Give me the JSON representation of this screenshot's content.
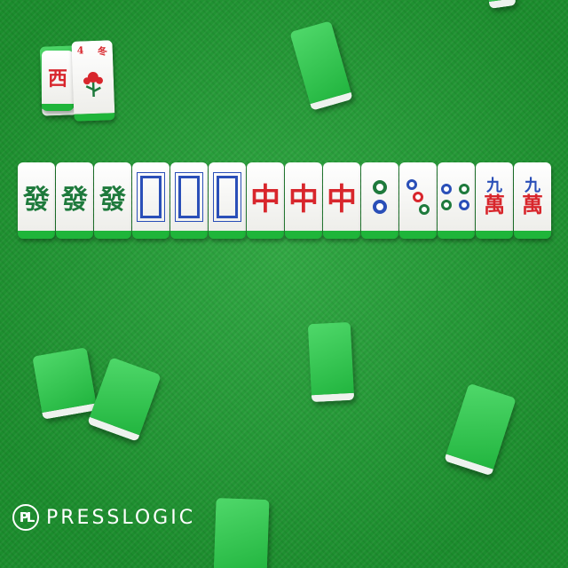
{
  "tiles_row": [
    {
      "kind": "character",
      "glyph": "發"
    },
    {
      "kind": "character",
      "glyph": "發"
    },
    {
      "kind": "character",
      "glyph": "發"
    },
    {
      "kind": "white-dragon"
    },
    {
      "kind": "white-dragon"
    },
    {
      "kind": "white-dragon"
    },
    {
      "kind": "character",
      "glyph": "中"
    },
    {
      "kind": "character",
      "glyph": "中"
    },
    {
      "kind": "character",
      "glyph": "中"
    },
    {
      "kind": "circles",
      "count": 2
    },
    {
      "kind": "circles",
      "count": 3
    },
    {
      "kind": "circles",
      "count": 4
    },
    {
      "kind": "wan",
      "number": "九",
      "suffix": "萬"
    },
    {
      "kind": "wan",
      "number": "九",
      "suffix": "萬"
    }
  ],
  "corner_tiles": {
    "west_wind": {
      "glyph": "西"
    },
    "flower": {
      "number": "4",
      "label": "冬"
    }
  },
  "logo": {
    "mark": "PL",
    "text": "PRESSLOGIC"
  },
  "colors": {
    "felt": "#1fa033",
    "tile_face": "#ffffff",
    "tile_back": "#22b53f",
    "red": "#d8262c",
    "green": "#1e7a3c",
    "blue": "#2a4fb8"
  }
}
